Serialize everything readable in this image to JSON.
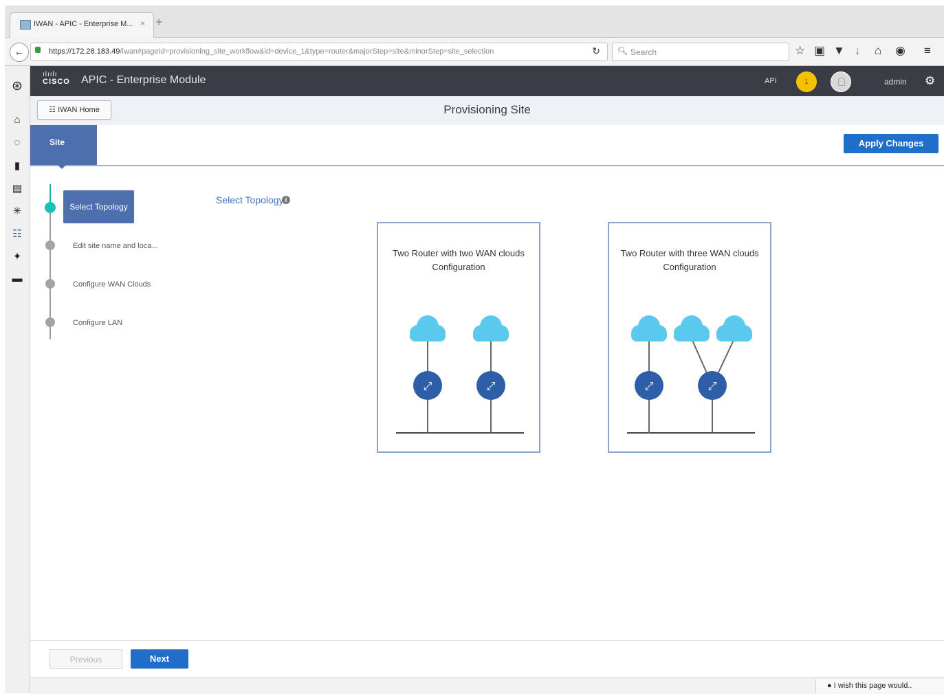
{
  "browser": {
    "tab_title": "IWAN - APIC - Enterprise M...",
    "tab_close": "×",
    "new_tab": "+",
    "url_host": "https://172.28.183.49",
    "url_path": "/iwan#pageId=provisioning_site_workflow&id=device_1&type=router&majorStep=site&minorStep=site_selection",
    "search_placeholder": "Search",
    "toolbar_icons": [
      "star-icon",
      "clipboard-icon",
      "pocket-icon",
      "download-icon",
      "home-icon",
      "chat-icon",
      "menu-icon"
    ]
  },
  "app": {
    "brand_bars": "ılıılı",
    "brand_word": "CISCO",
    "title": "APIC - Enterprise Module",
    "api_label": "API",
    "notification_count": "1",
    "user": "admin"
  },
  "subheader": {
    "home_button": "IWAN Home",
    "page_title": "Provisioning Site"
  },
  "stepbar": {
    "active_tab": "Site",
    "apply_label": "Apply Changes"
  },
  "wizard": {
    "steps": [
      {
        "label": "Select Topology",
        "active": true
      },
      {
        "label": "Edit site name and loca...",
        "active": false
      },
      {
        "label": "Configure WAN Clouds",
        "active": false
      },
      {
        "label": "Configure LAN",
        "active": false
      }
    ],
    "section_label": "Select Topology",
    "info_glyph": "i"
  },
  "topologies": [
    {
      "title_line1": "Two Router with two WAN clouds",
      "title_line2": "Configuration",
      "clouds": 2,
      "routers": 2
    },
    {
      "title_line1": "Two Router with three WAN clouds",
      "title_line2": "Configuration",
      "clouds": 3,
      "routers": 2
    }
  ],
  "footer": {
    "previous_label": "Previous",
    "next_label": "Next",
    "feedback_label": "I wish this page would.."
  },
  "colors": {
    "header_bg": "#3a3d44",
    "accent_blue": "#4d6fae",
    "button_blue": "#1f6ec9",
    "active_step": "#19c1b4",
    "cloud": "#5bc8ee",
    "router": "#2f5ea8",
    "notification": "#f2c200"
  }
}
